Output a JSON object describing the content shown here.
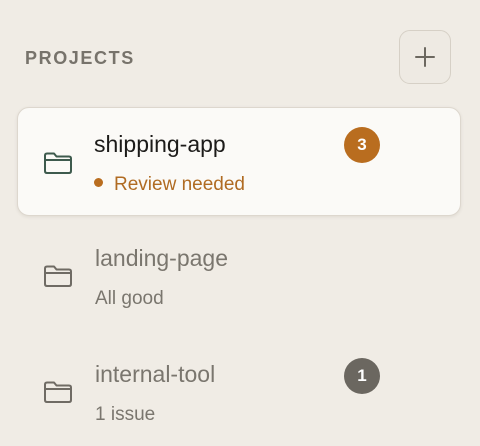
{
  "header": {
    "title": "PROJECTS",
    "add_button_icon": "plus-icon"
  },
  "colors": {
    "background": "#f0ece5",
    "active_card": "#fbfaf7",
    "review_accent": "#b96d1f",
    "muted_badge": "#6b6760",
    "active_folder_icon": "#3d5a4d",
    "inactive_folder_icon": "#6f6b64"
  },
  "projects": [
    {
      "name": "shipping-app",
      "status": "Review needed",
      "badge": "3",
      "icon": "folder-icon",
      "active": true
    },
    {
      "name": "landing-page",
      "status": "All good",
      "badge": "",
      "icon": "folder-icon",
      "active": false
    },
    {
      "name": "internal-tool",
      "status": "1 issue",
      "badge": "1",
      "icon": "folder-icon",
      "active": false
    }
  ]
}
